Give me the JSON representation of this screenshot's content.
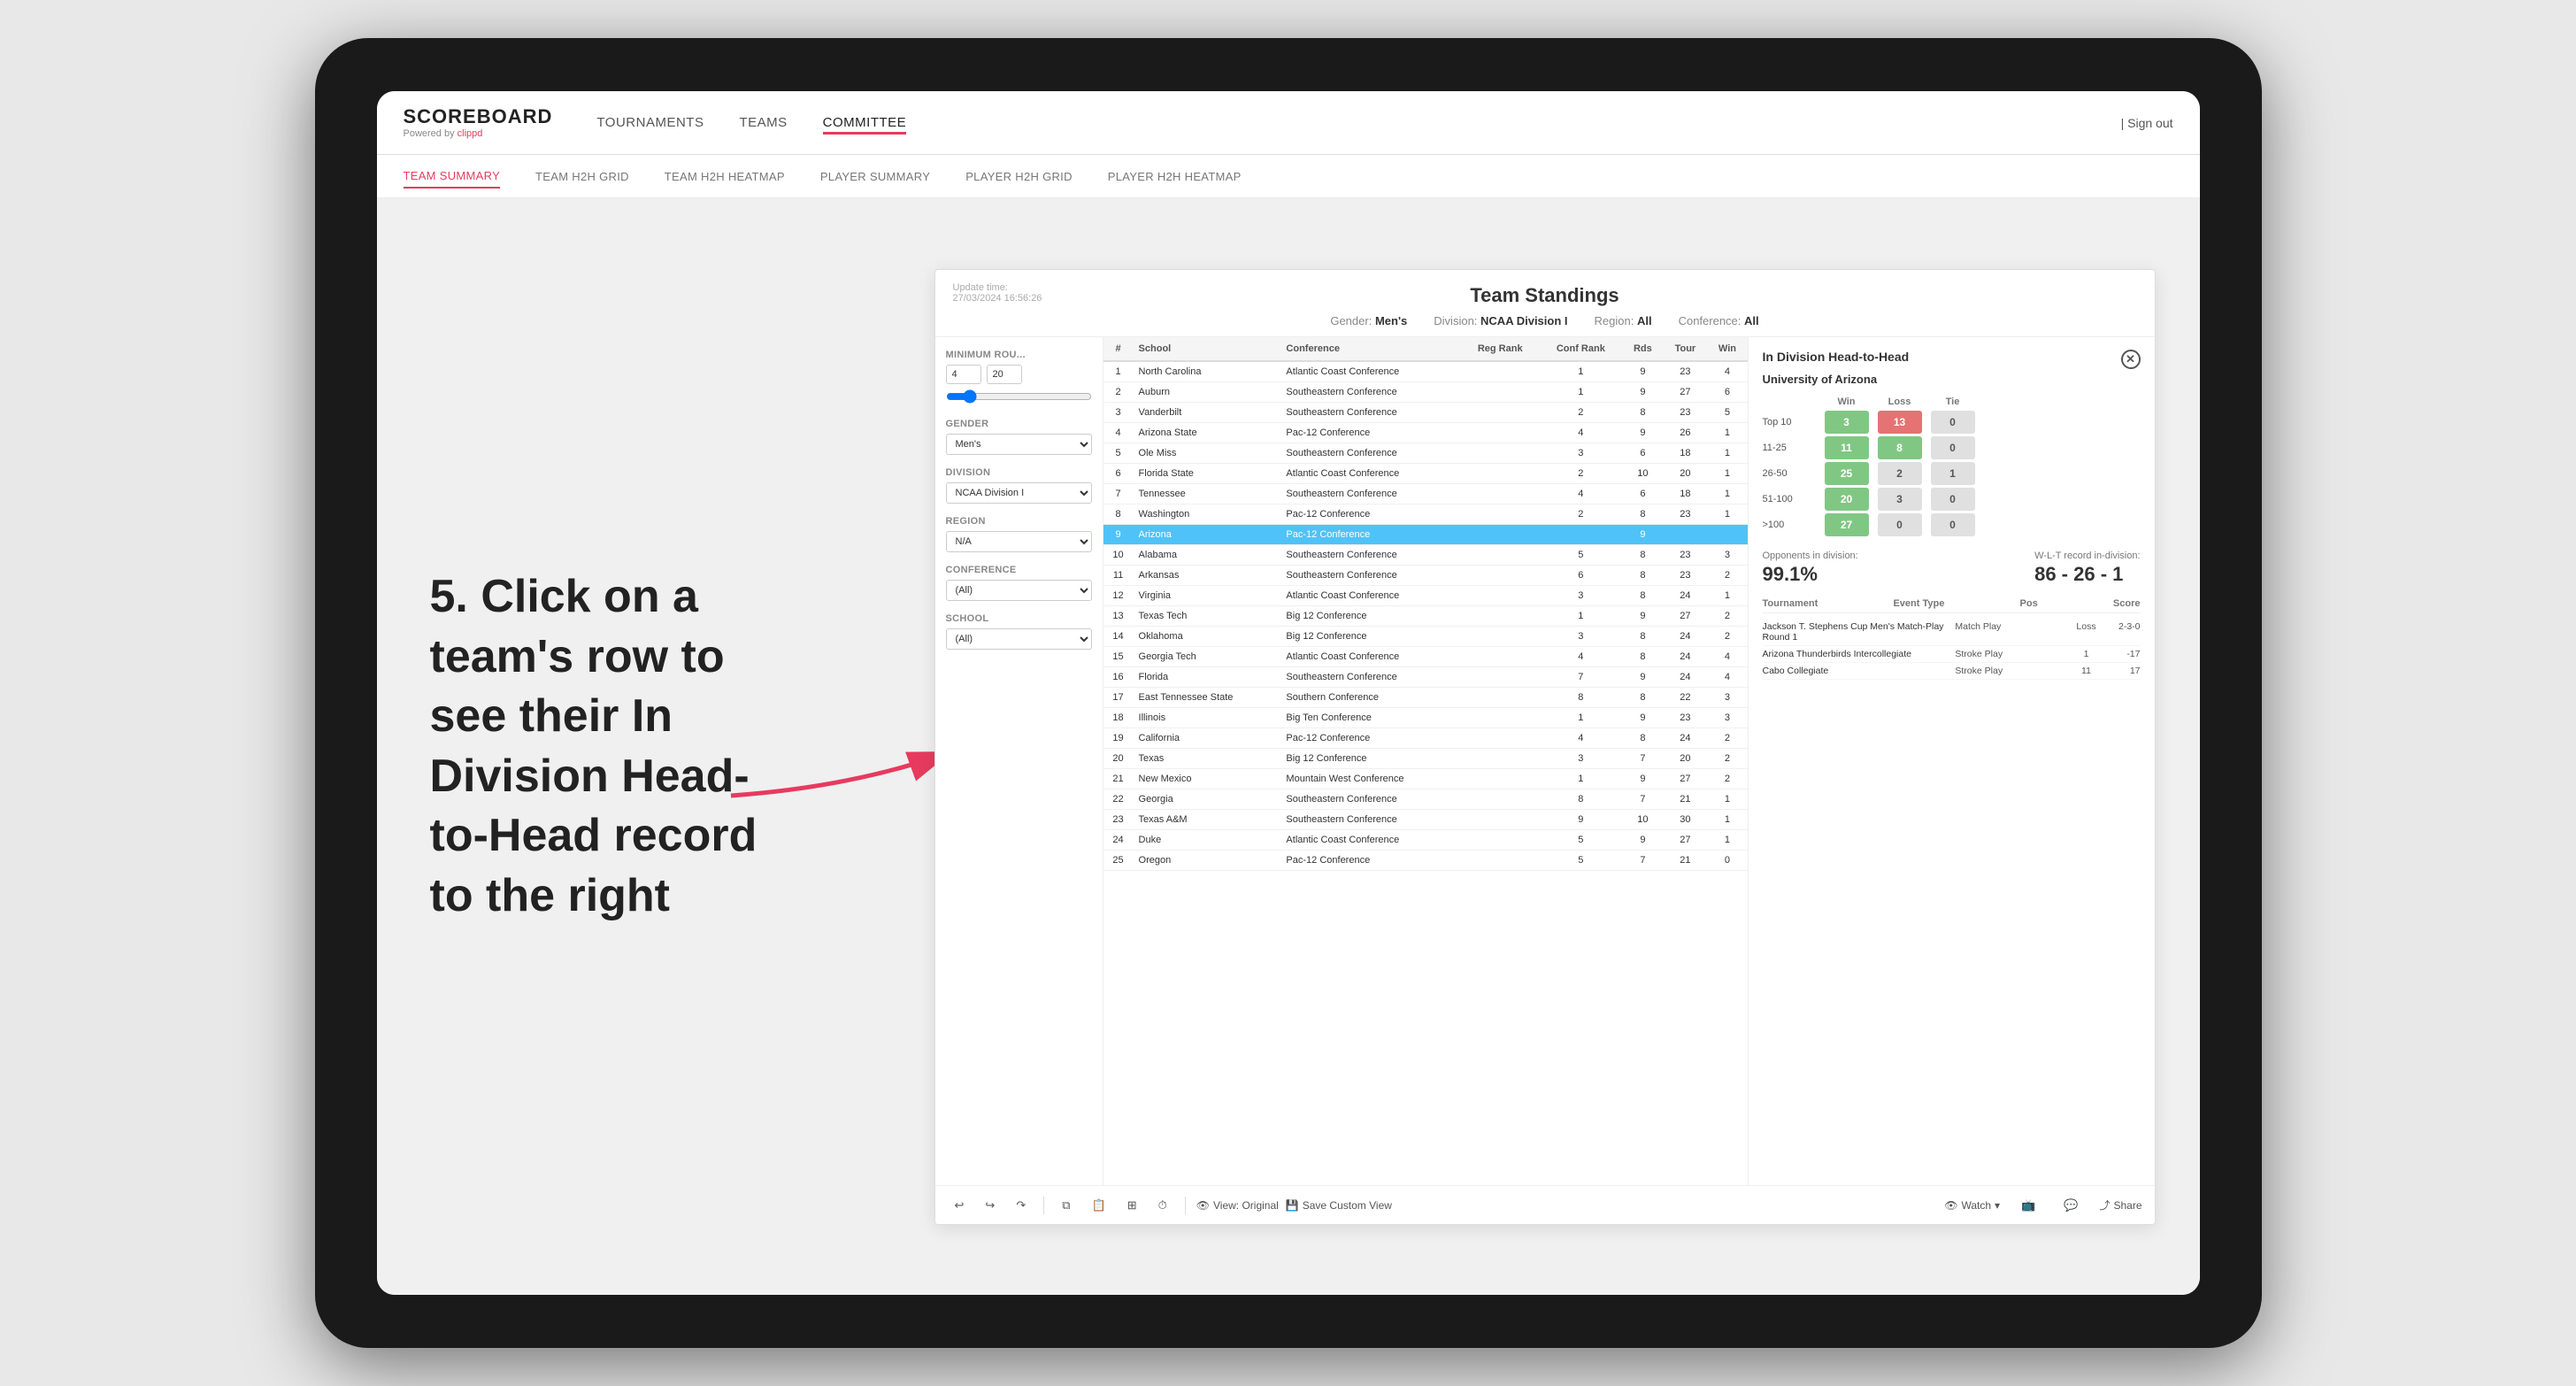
{
  "app": {
    "logo": "SCOREBOARD",
    "logo_sub": "Powered by ",
    "logo_brand": "clippd",
    "sign_out": "Sign out"
  },
  "main_nav": {
    "items": [
      {
        "label": "TOURNAMENTS",
        "active": false
      },
      {
        "label": "TEAMS",
        "active": false
      },
      {
        "label": "COMMITTEE",
        "active": true
      }
    ]
  },
  "sub_nav": {
    "items": [
      {
        "label": "TEAM SUMMARY",
        "active": true
      },
      {
        "label": "TEAM H2H GRID",
        "active": false
      },
      {
        "label": "TEAM H2H HEATMAP",
        "active": false
      },
      {
        "label": "PLAYER SUMMARY",
        "active": false
      },
      {
        "label": "PLAYER H2H GRID",
        "active": false
      },
      {
        "label": "PLAYER H2H HEATMAP",
        "active": false
      }
    ]
  },
  "annotation": {
    "text": "5. Click on a team's row to see their In Division Head-to-Head record to the right"
  },
  "dashboard": {
    "update_time_label": "Update time:",
    "update_time": "27/03/2024 16:56:26",
    "title": "Team Standings",
    "filters": {
      "gender_label": "Gender:",
      "gender_val": "Men's",
      "division_label": "Division:",
      "division_val": "NCAA Division I",
      "region_label": "Region:",
      "region_val": "All",
      "conference_label": "Conference:",
      "conference_val": "All"
    },
    "filter_panel": {
      "min_rounds_label": "Minimum Rou...",
      "min_rounds_val1": "4",
      "min_rounds_val2": "20",
      "gender_label": "Gender",
      "gender_val": "Men's",
      "division_label": "Division",
      "division_val": "NCAA Division I",
      "region_label": "Region",
      "region_val": "N/A",
      "conference_label": "Conference",
      "conference_val": "(All)",
      "school_label": "School",
      "school_val": "(All)"
    },
    "table": {
      "headers": [
        "#",
        "School",
        "Conference",
        "Reg Rank",
        "Conf Rank",
        "Rds",
        "Tour",
        "Win"
      ],
      "rows": [
        [
          1,
          "North Carolina",
          "Atlantic Coast Conference",
          "",
          1,
          9,
          23,
          4
        ],
        [
          2,
          "Auburn",
          "Southeastern Conference",
          "",
          1,
          9,
          27,
          6
        ],
        [
          3,
          "Vanderbilt",
          "Southeastern Conference",
          "",
          2,
          8,
          23,
          5
        ],
        [
          4,
          "Arizona State",
          "Pac-12 Conference",
          "",
          4,
          9,
          26,
          1
        ],
        [
          5,
          "Ole Miss",
          "Southeastern Conference",
          "",
          3,
          6,
          18,
          1
        ],
        [
          6,
          "Florida State",
          "Atlantic Coast Conference",
          "",
          2,
          10,
          20,
          1
        ],
        [
          7,
          "Tennessee",
          "Southeastern Conference",
          "",
          4,
          6,
          18,
          1
        ],
        [
          8,
          "Washington",
          "Pac-12 Conference",
          "",
          2,
          8,
          23,
          1
        ],
        [
          9,
          "Arizona",
          "Pac-12 Conference",
          "",
          "",
          9,
          "",
          ""
        ],
        [
          10,
          "Alabama",
          "Southeastern Conference",
          "",
          5,
          8,
          23,
          3
        ],
        [
          11,
          "Arkansas",
          "Southeastern Conference",
          "",
          6,
          8,
          23,
          2
        ],
        [
          12,
          "Virginia",
          "Atlantic Coast Conference",
          "",
          3,
          8,
          24,
          1
        ],
        [
          13,
          "Texas Tech",
          "Big 12 Conference",
          "",
          1,
          9,
          27,
          2
        ],
        [
          14,
          "Oklahoma",
          "Big 12 Conference",
          "",
          3,
          8,
          24,
          2
        ],
        [
          15,
          "Georgia Tech",
          "Atlantic Coast Conference",
          "",
          4,
          8,
          24,
          4
        ],
        [
          16,
          "Florida",
          "Southeastern Conference",
          "",
          7,
          9,
          24,
          4
        ],
        [
          17,
          "East Tennessee State",
          "Southern Conference",
          "",
          8,
          8,
          22,
          3
        ],
        [
          18,
          "Illinois",
          "Big Ten Conference",
          "",
          1,
          9,
          23,
          3
        ],
        [
          19,
          "California",
          "Pac-12 Conference",
          "",
          4,
          8,
          24,
          2
        ],
        [
          20,
          "Texas",
          "Big 12 Conference",
          "",
          3,
          7,
          20,
          2
        ],
        [
          21,
          "New Mexico",
          "Mountain West Conference",
          "",
          1,
          9,
          27,
          2
        ],
        [
          22,
          "Georgia",
          "Southeastern Conference",
          "",
          8,
          7,
          21,
          1
        ],
        [
          23,
          "Texas A&M",
          "Southeastern Conference",
          "",
          9,
          10,
          30,
          1
        ],
        [
          24,
          "Duke",
          "Atlantic Coast Conference",
          "",
          5,
          9,
          27,
          1
        ],
        [
          25,
          "Oregon",
          "Pac-12 Conference",
          "",
          5,
          7,
          21,
          0
        ]
      ]
    },
    "h2h": {
      "title": "In Division Head-to-Head",
      "team": "University of Arizona",
      "wlt_headers": [
        "Win",
        "Loss",
        "Tie"
      ],
      "rows": [
        {
          "label": "Top 10",
          "win": 3,
          "loss": 13,
          "tie": 0,
          "win_color": "green",
          "loss_color": "red",
          "tie_color": "gray"
        },
        {
          "label": "11-25",
          "win": 11,
          "loss": 8,
          "tie": 0,
          "win_color": "green",
          "loss_color": "green",
          "tie_color": "gray"
        },
        {
          "label": "26-50",
          "win": 25,
          "loss": 2,
          "tie": 1,
          "win_color": "green",
          "loss_color": "gray",
          "tie_color": "gray"
        },
        {
          "label": "51-100",
          "win": 20,
          "loss": 3,
          "tie": 0,
          "win_color": "green",
          "loss_color": "gray",
          "tie_color": "gray"
        },
        {
          "label": ">100",
          "win": 27,
          "loss": 0,
          "tie": 0,
          "win_color": "green",
          "loss_color": "gray",
          "tie_color": "gray"
        }
      ],
      "opponents_label": "Opponents in division:",
      "opponents_val": "99.1%",
      "wl_label": "W-L-T record in-division:",
      "wl_val": "86 - 26 - 1",
      "tournament_headers": [
        "Tournament",
        "Event Type",
        "Pos",
        "Score"
      ],
      "tournaments": [
        {
          "name": "Jackson T. Stephens Cup Men's Match-Play Round 1",
          "event": "Match Play",
          "result": "Loss",
          "pos": "2-3-0",
          "score": ""
        },
        {
          "name": "Arizona Thunderbirds Intercollegiate",
          "event": "Stroke Play",
          "pos": "1",
          "score": "-17"
        },
        {
          "name": "Cabo Collegiate",
          "event": "Stroke Play",
          "pos": "11",
          "score": "17"
        }
      ]
    },
    "toolbar": {
      "view_original": "View: Original",
      "save_custom": "Save Custom View",
      "watch": "Watch",
      "share": "Share"
    }
  }
}
